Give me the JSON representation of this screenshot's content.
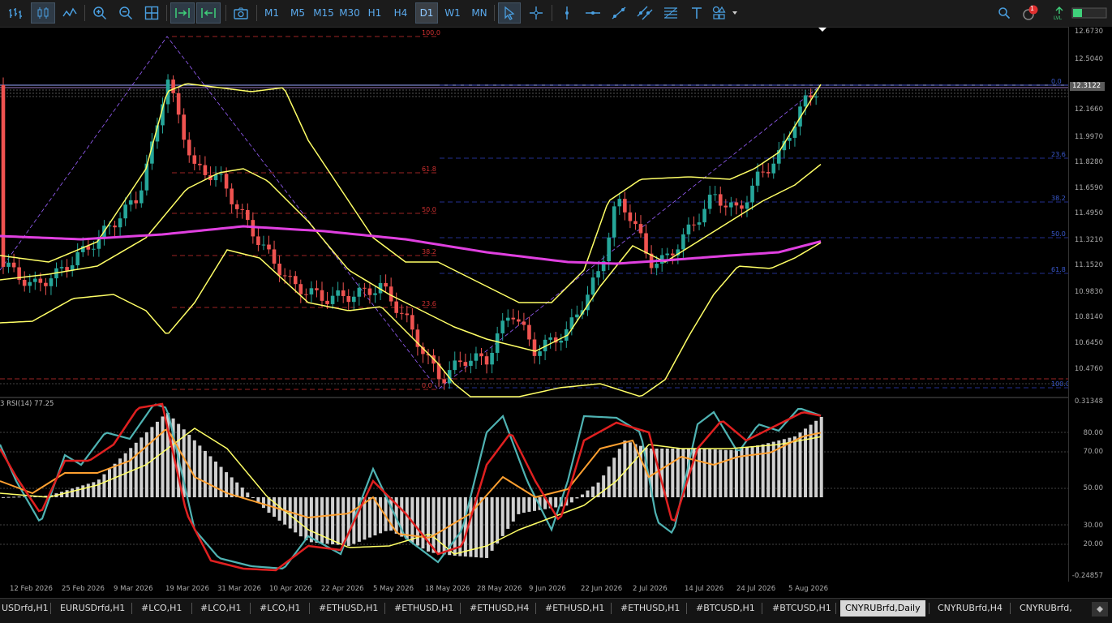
{
  "toolbar": {
    "timeframes": [
      "M1",
      "M5",
      "M15",
      "M30",
      "H1",
      "H4",
      "D1",
      "W1",
      "MN"
    ],
    "active_timeframe": "D1",
    "notification_count": "1"
  },
  "price_scale": [
    "12.6730",
    "12.5040",
    "12.3122",
    "12.1660",
    "11.9970",
    "11.8280",
    "11.6590",
    "11.4950",
    "11.3210",
    "11.1520",
    "10.9830",
    "10.8140",
    "10.6450",
    "10.4760"
  ],
  "current_price": "12.3122",
  "rsi_scale": [
    "0.31348",
    "80.00",
    "70.00",
    "50.00",
    "30.00",
    "20.00",
    "-0.24857"
  ],
  "rsi_label": "3 RSI(14) 77.25",
  "fib_left": [
    "100.0",
    "61.8",
    "50.0",
    "38.2",
    "23.6",
    "0.0"
  ],
  "fib_right": [
    "0.0",
    "23.6",
    "38.2",
    "50.0",
    "61.8",
    "100.0"
  ],
  "dates": [
    "12 Feb 2026",
    "25 Feb 2026",
    "9 Mar 2026",
    "19 Mar 2026",
    "31 Mar 2026",
    "10 Apr 2026",
    "22 Apr 2026",
    "5 May 2026",
    "18 May 2026",
    "28 May 2026",
    "9 Jun 2026",
    "22 Jun 2026",
    "2 Jul 2026",
    "14 Jul 2026",
    "24 Jul 2026",
    "5 Aug 2026"
  ],
  "tabs": [
    "USDrfd,H1",
    "EURUSDrfd,H1",
    "#LCO,H1",
    "#LCO,H1",
    "#LCO,H1",
    "#ETHUSD,H1",
    "#ETHUSD,H1",
    "#ETHUSD,H4",
    "#ETHUSD,H1",
    "#ETHUSD,H1",
    "#BTCUSD,H1",
    "#BTCUSD,H1",
    "CNYRUBrfd,Daily",
    "CNYRUBrfd,H4",
    "CNYRUBrfd,"
  ],
  "active_tab": "CNYRUBrfd,Daily",
  "colors": {
    "bull": "#26a69a",
    "bear": "#ef5350",
    "bands": "#ffff66",
    "ma": "#e040e0",
    "rsi_fast": "#4fb3b3",
    "rsi_red": "#e02020",
    "rsi_orange": "#ffa030"
  }
}
